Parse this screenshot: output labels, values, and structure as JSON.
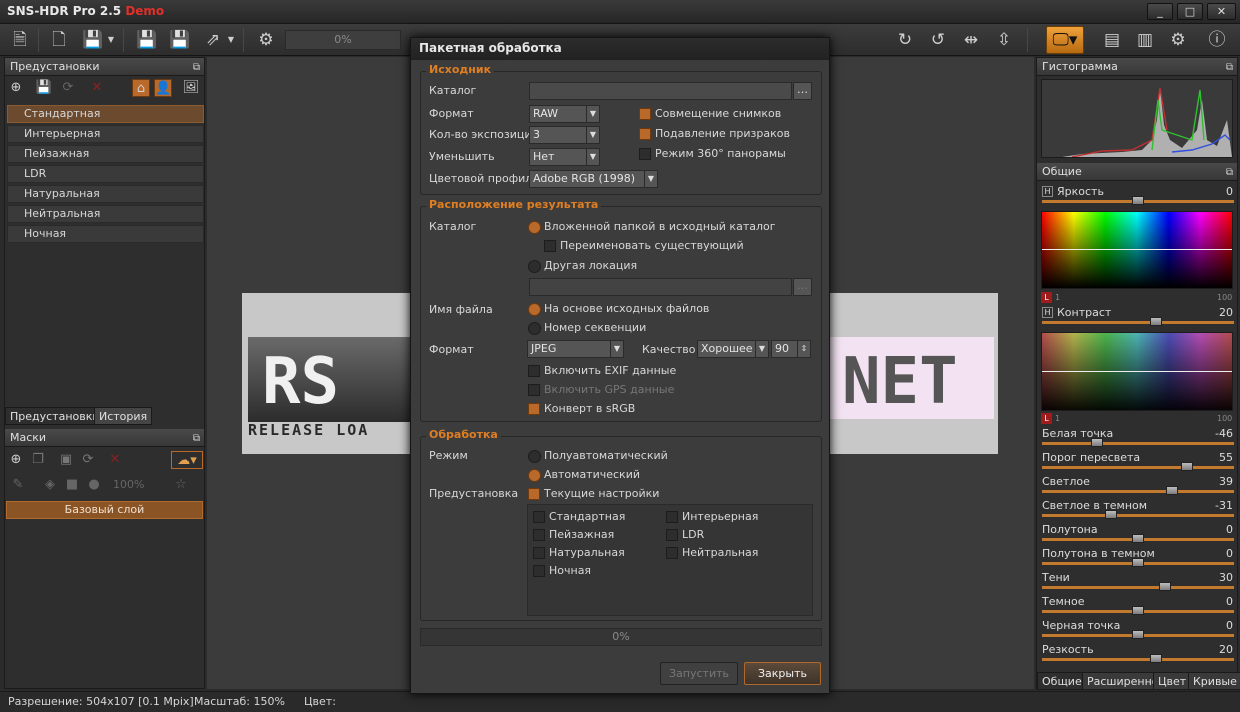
{
  "app": {
    "title": "SNS-HDR Pro 2.5",
    "demo": "Demo"
  },
  "toolbar": {
    "progress": "0%"
  },
  "left": {
    "presets_title": "Предустановки",
    "presets": [
      "Стандартная",
      "Интерьерная",
      "Пейзажная",
      "LDR",
      "Натуральная",
      "Нейтральная",
      "Ночная"
    ],
    "tabs": [
      "Предустановки",
      "История"
    ],
    "masks_title": "Маски",
    "zoom": "100%",
    "base_layer": "Базовый слой"
  },
  "image": {
    "left_text": "RS",
    "right_text": "NET",
    "sub_text": "RELEASE LOA"
  },
  "right": {
    "histogram_title": "Гистограмма",
    "general_title": "Общие",
    "brightness": {
      "label": "Яркость",
      "value": "0",
      "level": 0.5
    },
    "brightness_scale": [
      "1",
      "100"
    ],
    "contrast": {
      "label": "Контраст",
      "value": "20",
      "level": 0.6
    },
    "contrast_scale": [
      "1",
      "100"
    ],
    "sliders": [
      {
        "label": "Белая точка",
        "value": "-46",
        "level": 0.27
      },
      {
        "label": "Порог пересвета",
        "value": "55",
        "level": 0.77
      },
      {
        "label": "Светлое",
        "value": "39",
        "level": 0.69
      },
      {
        "label": "Светлое в темном",
        "value": "-31",
        "level": 0.35
      },
      {
        "label": "Полутона",
        "value": "0",
        "level": 0.5
      },
      {
        "label": "Полутона в темном",
        "value": "0",
        "level": 0.5
      },
      {
        "label": "Тени",
        "value": "30",
        "level": 0.65
      },
      {
        "label": "Темное",
        "value": "0",
        "level": 0.5
      },
      {
        "label": "Черная точка",
        "value": "0",
        "level": 0.5
      },
      {
        "label": "Резкость",
        "value": "20",
        "level": 0.6
      }
    ],
    "tabs": [
      "Общие",
      "Расширенно",
      "Цвет",
      "Кривые"
    ]
  },
  "status": {
    "resolution": "Разрешение: 504x107 [0.1 Mpix]",
    "scale": "Масштаб: 150%",
    "color": "Цвет:"
  },
  "dialog": {
    "title": "Пакетная обработка",
    "source": {
      "title": "Исходник",
      "catalog_label": "Каталог",
      "format_label": "Формат",
      "format": "RAW",
      "exposures_label": "Кол-во экспозиций",
      "exposures": "3",
      "reduce_label": "Уменьшить",
      "reduce": "Нет",
      "profile_label": "Цветовой профиль",
      "profile": "Adobe RGB (1998)",
      "align": "Совмещение снимков",
      "deghost": "Подавление призраков",
      "pano": "Режим 360° панорамы"
    },
    "output": {
      "title": "Расположение результата",
      "catalog_label": "Каталог",
      "subfolder": "Вложенной папкой в исходный каталог",
      "rename": "Переименовать существующий",
      "other": "Другая локация",
      "filename_label": "Имя файла",
      "based": "На основе исходных файлов",
      "sequence": "Номер секвенции",
      "format_label": "Формат",
      "format": "JPEG",
      "quality_label": "Качество",
      "quality": "Хорошее",
      "quality_value": "90",
      "exif": "Включить  EXIF данные",
      "gps": "Включить GPS данные",
      "srgb": "Конверт в  sRGB"
    },
    "processing": {
      "title": "Обработка",
      "mode_label": "Режим",
      "semi": "Полуавтоматический",
      "auto": "Автоматический",
      "preset_label": "Предустановка",
      "current": "Текущие настройки",
      "presets": [
        "Стандартная",
        "Интерьерная",
        "Пейзажная",
        "LDR",
        "Натуральная",
        "Нейтральная",
        "Ночная"
      ]
    },
    "progress": "0%",
    "run": "Запустить",
    "close": "Закрыть"
  }
}
